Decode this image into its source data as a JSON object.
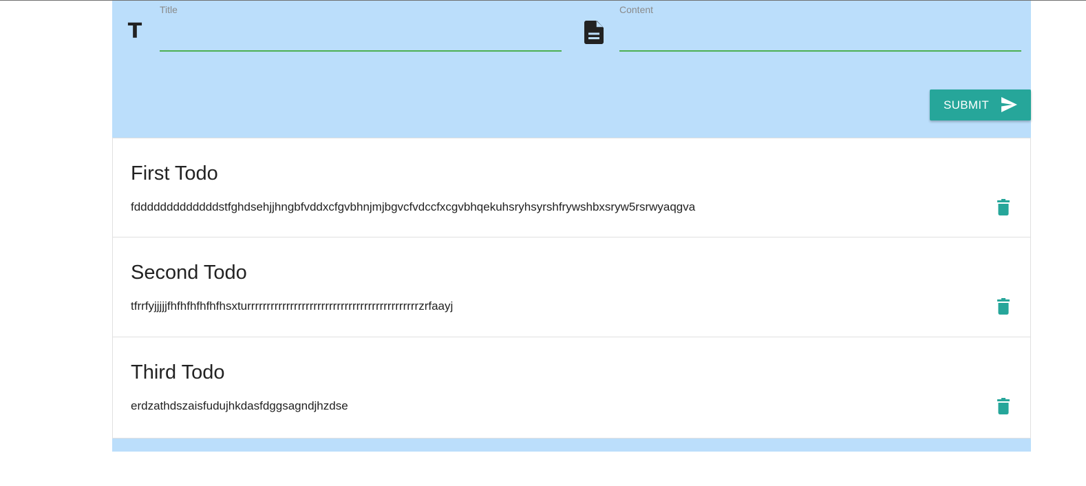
{
  "form": {
    "title_icon": "title-icon",
    "title_icon_glyph": "T",
    "title_label": "Title",
    "title_value": "",
    "content_icon": "description-icon",
    "content_label": "Content",
    "content_value": "",
    "submit_label": "SUBMIT",
    "submit_icon": "send-icon"
  },
  "todos": [
    {
      "title": "First Todo",
      "content": "fdddddddddddddstfghdsehjjhngbfvddxcfgvbhnjmjbgvcfvdccfxcgvbhqekuhsryhsyrshfrywshbxsryw5rsrwyaqgva",
      "delete_icon": "delete-icon"
    },
    {
      "title": "Second Todo",
      "content": "tfrrfyjjjjjfhfhfhfhfhfhsxturrrrrrrrrrrrrrrrrrrrrrrrrrrrrrrrrrrrrrrrrrrrzrfaayj",
      "delete_icon": "delete-icon"
    },
    {
      "title": "Third Todo",
      "content": "erdzathdszaisfudujhkdasfdggsagndjhzdse",
      "delete_icon": "delete-icon"
    }
  ],
  "colors": {
    "app_background": "#bbdefb",
    "accent": "#26a69a",
    "input_underline": "#4caf50"
  }
}
